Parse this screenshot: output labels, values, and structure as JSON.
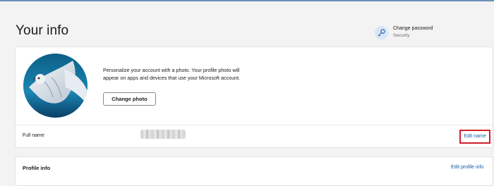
{
  "header": {
    "title": "Your info"
  },
  "change_password": {
    "title": "Change password",
    "subtitle": "Security",
    "icon": "key-icon"
  },
  "photo_section": {
    "description": "Personalize your account with a photo. Your profile photo will appear on apps and devices that use your Microsoft account.",
    "change_photo_label": "Change photo",
    "avatar_icon": "snowy-owl-photo"
  },
  "full_name": {
    "label": "Full name",
    "value_redacted": true,
    "edit_label": "Edit name"
  },
  "profile_info": {
    "title": "Profile info",
    "edit_label": "Edit profile info"
  },
  "colors": {
    "link": "#0f5ea8",
    "highlight_border": "#d0202a",
    "background": "#f3f3f3",
    "card": "#ffffff"
  }
}
